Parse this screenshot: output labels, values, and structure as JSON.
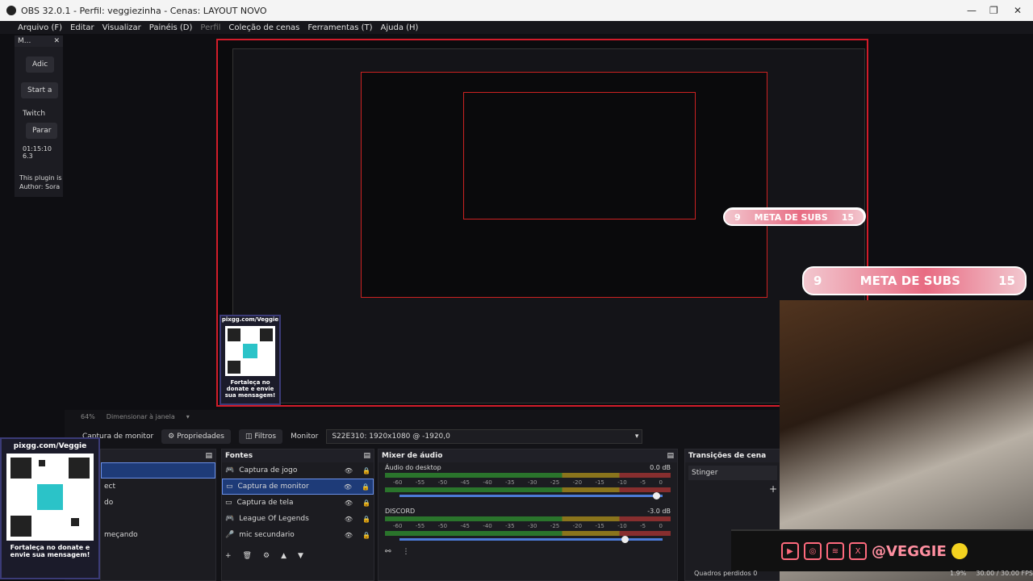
{
  "window": {
    "title": "OBS 32.0.1 - Perfil: veggiezinha - Cenas: LAYOUT NOVO",
    "controls": [
      "—",
      "❐",
      "✕"
    ]
  },
  "menu": [
    {
      "label": "Arquivo (F)",
      "enabled": true
    },
    {
      "label": "Editar",
      "enabled": true
    },
    {
      "label": "Visualizar",
      "enabled": true
    },
    {
      "label": "Painéis (D)",
      "enabled": true
    },
    {
      "label": "Perfil",
      "enabled": false
    },
    {
      "label": "Coleção de cenas",
      "enabled": true
    },
    {
      "label": "Ferramentas (T)",
      "enabled": true
    },
    {
      "label": "Ajuda (H)",
      "enabled": true
    }
  ],
  "left_dock": {
    "title": "M...",
    "add_button": "Adic",
    "start_button": "Start a",
    "twitch_label": "Twitch",
    "stop_button": "Parar",
    "timer": "01:15:10",
    "timer_extra": "6.3",
    "plugin_note": "This plugin is",
    "author_note": "Author: Sora"
  },
  "preview": {
    "zoom": "64%",
    "fit_label": "Dimensionar à janela"
  },
  "overlay": {
    "meta_label": "META DE SUBS",
    "meta_current": "9",
    "meta_goal": "15",
    "qr_url": "pixgg.com/Veggie",
    "qr_caption": "Fortaleça no donate e envie sua mensagem!",
    "social_handle": "@VEGGIE"
  },
  "source_toolbar": {
    "selected_source": "Captura de monitor",
    "properties_label": "Propriedades",
    "filters_label": "Filtros",
    "monitor_label": "Monitor",
    "monitor_value": "S22E310: 1920x1080 @ -1920,0"
  },
  "scenes_panel": {
    "items": [
      "",
      "ect",
      "do",
      "meçando"
    ]
  },
  "sources_panel": {
    "title": "Fontes",
    "items": [
      {
        "label": "Captura de jogo",
        "selected": false
      },
      {
        "label": "Captura de monitor",
        "selected": true
      },
      {
        "label": "Captura de tela",
        "selected": false
      },
      {
        "label": "League Of Legends",
        "selected": false
      },
      {
        "label": "mic secundario",
        "selected": false
      }
    ]
  },
  "mixer_panel": {
    "title": "Mixer de áudio",
    "ticks": [
      "-60",
      "-55",
      "-50",
      "-45",
      "-40",
      "-35",
      "-30",
      "-25",
      "-20",
      "-15",
      "-10",
      "-5",
      "0"
    ],
    "channels": [
      {
        "name": "Áudio do desktop",
        "db": "0.0 dB",
        "level": 0.98
      },
      {
        "name": "DISCORD",
        "db": "-3.0 dB",
        "level": 0.86
      }
    ]
  },
  "transitions_panel": {
    "title": "Transições de cena",
    "value": "Stinger"
  },
  "status": {
    "dropped": "Quadros perdidos 0",
    "cpu": "1.9%",
    "fps": "30.00 / 30.00 FPS"
  },
  "colors": {
    "accent_red": "#d21c2a",
    "selection_blue": "#1e3b78",
    "overlay_pink": "#e86b82"
  }
}
